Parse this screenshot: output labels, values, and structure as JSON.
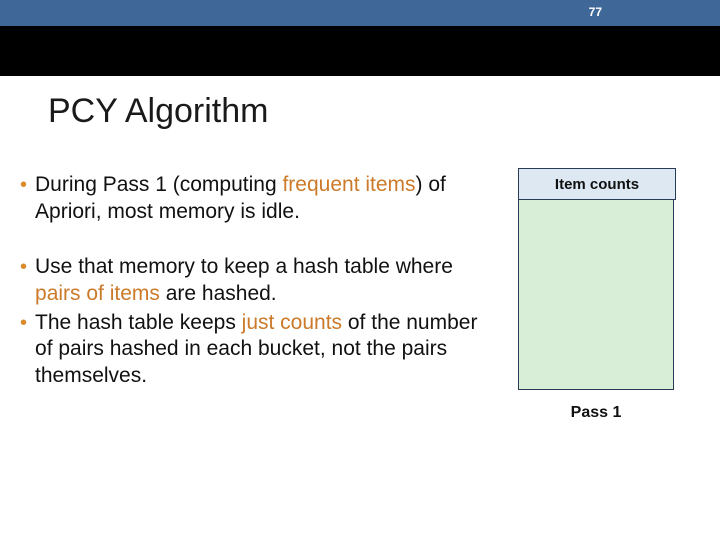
{
  "page_number": "77",
  "title": "PCY Algorithm",
  "bullets": {
    "b1_pre": "During Pass 1 (computing ",
    "b1_hl": "frequent items",
    "b1_post": ") of Apriori, most memory is idle.",
    "b2_pre": "Use that memory to keep a hash table where ",
    "b2_hl": "pairs of items",
    "b2_post": " are hashed.",
    "b3_pre": "The hash table keeps ",
    "b3_hl": "just counts",
    "b3_post": " of the number of pairs hashed in each bucket, not the pairs themselves."
  },
  "diagram": {
    "item_counts_label": "Item counts",
    "pass_label": "Pass 1"
  }
}
